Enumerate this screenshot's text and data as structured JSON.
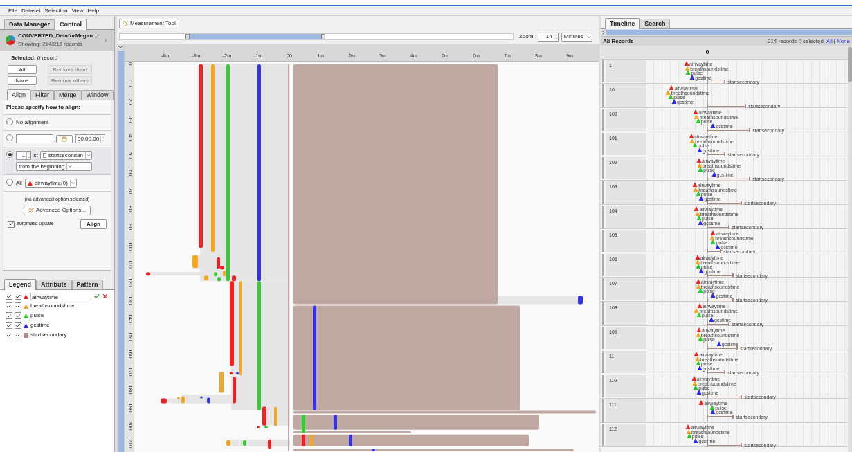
{
  "menu": [
    {
      "label": "File"
    },
    {
      "label": "Dataset"
    },
    {
      "label": "Selection"
    },
    {
      "label": "View"
    },
    {
      "label": "Help"
    }
  ],
  "left_tabs": [
    {
      "label": "Data Manager",
      "selected": false
    },
    {
      "label": "Control",
      "selected": true
    }
  ],
  "dataset": {
    "name": "CONVERTED_DataforMegan...",
    "showing": "Showing: 214/215 records"
  },
  "selection": "**Selected:** 0 record",
  "selection_buttons": [
    {
      "label": "All",
      "disabled": false
    },
    {
      "label": "Remove them",
      "disabled": true
    },
    {
      "label": "None",
      "disabled": false
    },
    {
      "label": "Remove others",
      "disabled": true
    }
  ],
  "control_tabs": [
    {
      "label": "Align",
      "selected": true
    },
    {
      "label": "Filter",
      "selected": false
    },
    {
      "label": "Merge",
      "selected": false
    },
    {
      "label": "Window",
      "selected": false
    }
  ],
  "align": {
    "prompt": "Please specify how to align:",
    "options": [
      {
        "kind": "none",
        "selected": false,
        "label": "No alignment"
      },
      {
        "kind": "time",
        "selected": false,
        "time": "00:00:00"
      },
      {
        "kind": "nth",
        "selected": true,
        "count": "1",
        "suffix": "st",
        "event": "startsecondan",
        "from": "from the beginning"
      },
      {
        "kind": "all",
        "selected": false,
        "label": "All",
        "event": "airwaytime(0)"
      }
    ],
    "advanced_note": "(no advanced option selected)",
    "advanced_button": "Advanced Options...",
    "auto_update": {
      "label": "automatic update",
      "checked": true
    },
    "align_button": "Align"
  },
  "legend_tabs": [
    {
      "label": "Legend",
      "selected": true
    },
    {
      "label": "Attribute",
      "selected": false
    },
    {
      "label": "Pattern",
      "selected": false
    }
  ],
  "legend": [
    {
      "name": "airwaytime",
      "kind": "point",
      "color": "#ee2222",
      "checked": true,
      "checked_2": true,
      "editing": true
    },
    {
      "name": "breathsoundstime",
      "kind": "point",
      "color": "#f5a623",
      "checked": true,
      "checked_2": true,
      "editing": false
    },
    {
      "name": "pulse",
      "kind": "point",
      "color": "#22cc22",
      "checked": true,
      "checked_2": true,
      "editing": false
    },
    {
      "name": "gcstime",
      "kind": "point",
      "color": "#2a2aee",
      "checked": true,
      "checked_2": true,
      "editing": false
    },
    {
      "name": "startsecondary",
      "kind": "interval",
      "color": "#a88a84",
      "checked": true,
      "checked_2": true,
      "editing": false
    }
  ],
  "measurement_button": "Measurement Tool",
  "zoom": {
    "label": "Zoom:",
    "value": "14",
    "unit": "Minutes"
  },
  "overview": {
    "x_labels": [
      "-4m",
      "-3m",
      "-2m",
      "-1m",
      "00",
      "1m",
      "2m",
      "3m",
      "4m",
      "5m",
      "6m",
      "7m",
      "8m",
      "9m"
    ],
    "y_labels": [
      "0",
      "10",
      "20",
      "30",
      "40",
      "50",
      "60",
      "70",
      "80",
      "90",
      "100",
      "110",
      "120",
      "130",
      "140",
      "150",
      "160",
      "170",
      "180",
      "190",
      "200",
      "210"
    ]
  },
  "timeline_tabs": [
    {
      "label": "Timeline",
      "selected": true
    },
    {
      "label": "Search",
      "selected": false
    }
  ],
  "records_header": {
    "title": "All Records",
    "summary": "214 records 0 selected",
    "links": [
      "All",
      "None"
    ],
    "separator": "|"
  },
  "axis_label": "0",
  "records": [
    {
      "id": "1",
      "events": [
        {
          "name": "airwaytime",
          "kind": "point",
          "color": "#ee2222",
          "level": 0.205
        },
        {
          "name": "breathsoundstime",
          "kind": "point",
          "color": "#f5a623",
          "level": 0.209
        },
        {
          "name": "pulse",
          "kind": "point",
          "color": "#22cc22",
          "level": 0.213
        },
        {
          "name": "gcstime",
          "kind": "point",
          "color": "#2a2aee",
          "level": 0.233
        },
        {
          "name": "startsecondary",
          "kind": "interval",
          "color": "#a88a84",
          "level": 0.393
        }
      ]
    },
    {
      "id": "10",
      "events": [
        {
          "name": "airwaytime",
          "kind": "point",
          "color": "#ee2222",
          "level": 0.131
        },
        {
          "name": "breathsoundstime",
          "kind": "point",
          "color": "#f5a623",
          "level": 0.114
        },
        {
          "name": "pulse",
          "kind": "point",
          "color": "#22cc22",
          "level": 0.127
        },
        {
          "name": "gcstime",
          "kind": "point",
          "color": "#2a2aee",
          "level": 0.143
        },
        {
          "name": "startsecondary",
          "kind": "interval",
          "color": "#a88a84",
          "level": 0.496
        }
      ]
    },
    {
      "id": "100",
      "events": [
        {
          "name": "airwaytime",
          "kind": "point",
          "color": "#ee2222",
          "level": 0.25
        },
        {
          "name": "breathsoundstime",
          "kind": "point",
          "color": "#f5a623",
          "level": 0.254
        },
        {
          "name": "pulse",
          "kind": "point",
          "color": "#22cc22",
          "level": 0.262
        },
        {
          "name": "gcstime",
          "kind": "point",
          "color": "#2a2aee",
          "level": 0.336
        },
        {
          "name": "startsecondary",
          "kind": "interval",
          "color": "#a88a84",
          "level": 0.516
        }
      ]
    },
    {
      "id": "101",
      "events": [
        {
          "name": "airwaytime",
          "kind": "point",
          "color": "#ee2222",
          "level": 0.229
        },
        {
          "name": "breathsoundstime",
          "kind": "point",
          "color": "#f5a623",
          "level": 0.233
        },
        {
          "name": "pulse",
          "kind": "point",
          "color": "#22cc22",
          "level": 0.246
        },
        {
          "name": "gcstime",
          "kind": "point",
          "color": "#2a2aee",
          "level": 0.27
        },
        {
          "name": "startsecondary",
          "kind": "interval",
          "color": "#a88a84",
          "level": 0.393
        }
      ]
    },
    {
      "id": "102",
      "events": [
        {
          "name": "airwaytime",
          "kind": "point",
          "color": "#ee2222",
          "level": 0.266
        },
        {
          "name": "breathsoundstime",
          "kind": "point",
          "color": "#f5a623",
          "level": 0.268
        },
        {
          "name": "pulse",
          "kind": "point",
          "color": "#22cc22",
          "level": 0.274
        },
        {
          "name": "gcstime",
          "kind": "point",
          "color": "#2a2aee",
          "level": 0.34
        },
        {
          "name": "startsecondary",
          "kind": "interval",
          "color": "#a88a84",
          "level": 0.516
        }
      ]
    },
    {
      "id": "103",
      "events": [
        {
          "name": "airwaytime",
          "kind": "point",
          "color": "#ee2222",
          "level": 0.246
        },
        {
          "name": "breathsoundstime",
          "kind": "point",
          "color": "#f5a623",
          "level": 0.25
        },
        {
          "name": "pulse",
          "kind": "point",
          "color": "#22cc22",
          "level": 0.262
        },
        {
          "name": "gcstime",
          "kind": "point",
          "color": "#2a2aee",
          "level": 0.278
        },
        {
          "name": "startsecondary",
          "kind": "interval",
          "color": "#a88a84",
          "level": 0.475
        }
      ]
    },
    {
      "id": "104",
      "events": [
        {
          "name": "airwaytime",
          "kind": "point",
          "color": "#ee2222",
          "level": 0.254
        },
        {
          "name": "breathsoundstime",
          "kind": "point",
          "color": "#f5a623",
          "level": 0.258
        },
        {
          "name": "pulse",
          "kind": "point",
          "color": "#22cc22",
          "level": 0.266
        },
        {
          "name": "gcstime",
          "kind": "point",
          "color": "#2a2aee",
          "level": 0.274
        },
        {
          "name": "startsecondary",
          "kind": "interval",
          "color": "#a88a84",
          "level": 0.414
        }
      ]
    },
    {
      "id": "105",
      "events": [
        {
          "name": "airwaytime",
          "kind": "point",
          "color": "#ee2222",
          "level": 0.336
        },
        {
          "name": "breathsoundstime",
          "kind": "point",
          "color": "#f5a623",
          "level": 0.332
        },
        {
          "name": "pulse",
          "kind": "point",
          "color": "#22cc22",
          "level": 0.336
        },
        {
          "name": "gcstime",
          "kind": "point",
          "color": "#2a2aee",
          "level": 0.36
        },
        {
          "name": "startsecondary",
          "kind": "interval",
          "color": "#a88a84",
          "level": 0.373
        }
      ]
    },
    {
      "id": "106",
      "events": [
        {
          "name": "airwaytime",
          "kind": "point",
          "color": "#ee2222",
          "level": 0.258
        },
        {
          "name": "breathsoundstime",
          "kind": "point",
          "color": "#f5a623",
          "level": 0.26
        },
        {
          "name": "pulse",
          "kind": "point",
          "color": "#22cc22",
          "level": 0.262
        },
        {
          "name": "gcstime",
          "kind": "point",
          "color": "#2a2aee",
          "level": 0.278
        },
        {
          "name": "startsecondary",
          "kind": "interval",
          "color": "#a88a84",
          "level": 0.434
        }
      ]
    },
    {
      "id": "107",
      "events": [
        {
          "name": "airwaytime",
          "kind": "point",
          "color": "#ee2222",
          "level": 0.262
        },
        {
          "name": "breathsoundstime",
          "kind": "point",
          "color": "#f5a623",
          "level": 0.262
        },
        {
          "name": "pulse",
          "kind": "point",
          "color": "#22cc22",
          "level": 0.274
        },
        {
          "name": "gcstime",
          "kind": "point",
          "color": "#2a2aee",
          "level": 0.336
        },
        {
          "name": "startsecondary",
          "kind": "interval",
          "color": "#a88a84",
          "level": 0.434
        }
      ]
    },
    {
      "id": "108",
      "events": [
        {
          "name": "airwaytime",
          "kind": "point",
          "color": "#ee2222",
          "level": 0.27
        },
        {
          "name": "breathsoundstime",
          "kind": "point",
          "color": "#f5a623",
          "level": 0.254
        },
        {
          "name": "pulse",
          "kind": "point",
          "color": "#22cc22",
          "level": 0.266
        },
        {
          "name": "gcstime",
          "kind": "point",
          "color": "#2a2aee",
          "level": 0.328
        },
        {
          "name": "startsecondary",
          "kind": "interval",
          "color": "#a88a84",
          "level": 0.414
        }
      ]
    },
    {
      "id": "109",
      "events": [
        {
          "name": "airwaytime",
          "kind": "point",
          "color": "#ee2222",
          "level": 0.266
        },
        {
          "name": "breathsoundstime",
          "kind": "point",
          "color": "#f5a623",
          "level": 0.262
        },
        {
          "name": "pulse",
          "kind": "point",
          "color": "#22cc22",
          "level": 0.274
        },
        {
          "name": "gcstime",
          "kind": "point",
          "color": "#2a2aee",
          "level": 0.364
        },
        {
          "name": "startsecondary",
          "kind": "interval",
          "color": "#a88a84",
          "level": 0.455
        }
      ]
    },
    {
      "id": "11",
      "events": [
        {
          "name": "airwaytime",
          "kind": "point",
          "color": "#ee2222",
          "level": 0.254
        },
        {
          "name": "breathsoundstime",
          "kind": "point",
          "color": "#f5a623",
          "level": 0.258
        },
        {
          "name": "pulse",
          "kind": "point",
          "color": "#22cc22",
          "level": 0.262
        },
        {
          "name": "gcstime",
          "kind": "point",
          "color": "#2a2aee",
          "level": 0.27
        },
        {
          "name": "startsecondary",
          "kind": "interval",
          "color": "#a88a84",
          "level": 0.393
        }
      ]
    },
    {
      "id": "110",
      "events": [
        {
          "name": "airwaytime",
          "kind": "point",
          "color": "#ee2222",
          "level": 0.241
        },
        {
          "name": "breathsoundstime",
          "kind": "point",
          "color": "#f5a623",
          "level": 0.246
        },
        {
          "name": "pulse",
          "kind": "point",
          "color": "#22cc22",
          "level": 0.25
        },
        {
          "name": "gcstime",
          "kind": "point",
          "color": "#2a2aee",
          "level": 0.266
        },
        {
          "name": "startsecondary",
          "kind": "interval",
          "color": "#a88a84",
          "level": 0.475
        }
      ]
    },
    {
      "id": "111",
      "events": [
        {
          "name": "airwaytime",
          "kind": "point",
          "color": "#ee2222",
          "level": 0.278
        },
        {
          "name": "pulse",
          "kind": "point",
          "color": "#22cc22",
          "level": 0.332
        },
        {
          "name": "gcstime",
          "kind": "point",
          "color": "#2a2aee",
          "level": 0.336
        },
        {
          "name": "startsecondary",
          "kind": "interval",
          "color": "#a88a84",
          "level": 0.434
        }
      ]
    },
    {
      "id": "112",
      "events": [
        {
          "name": "airwaytime",
          "kind": "point",
          "color": "#ee2222",
          "level": 0.213
        },
        {
          "name": "breathsoundstime",
          "kind": "point",
          "color": "#f5a623",
          "level": 0.215
        },
        {
          "name": "pulse",
          "kind": "point",
          "color": "#22cc22",
          "level": 0.217
        },
        {
          "name": "gcstime",
          "kind": "point",
          "color": "#2a2aee",
          "level": 0.25
        },
        {
          "name": "startsecondary",
          "kind": "interval",
          "color": "#a88a84",
          "level": 0.475
        }
      ]
    }
  ]
}
